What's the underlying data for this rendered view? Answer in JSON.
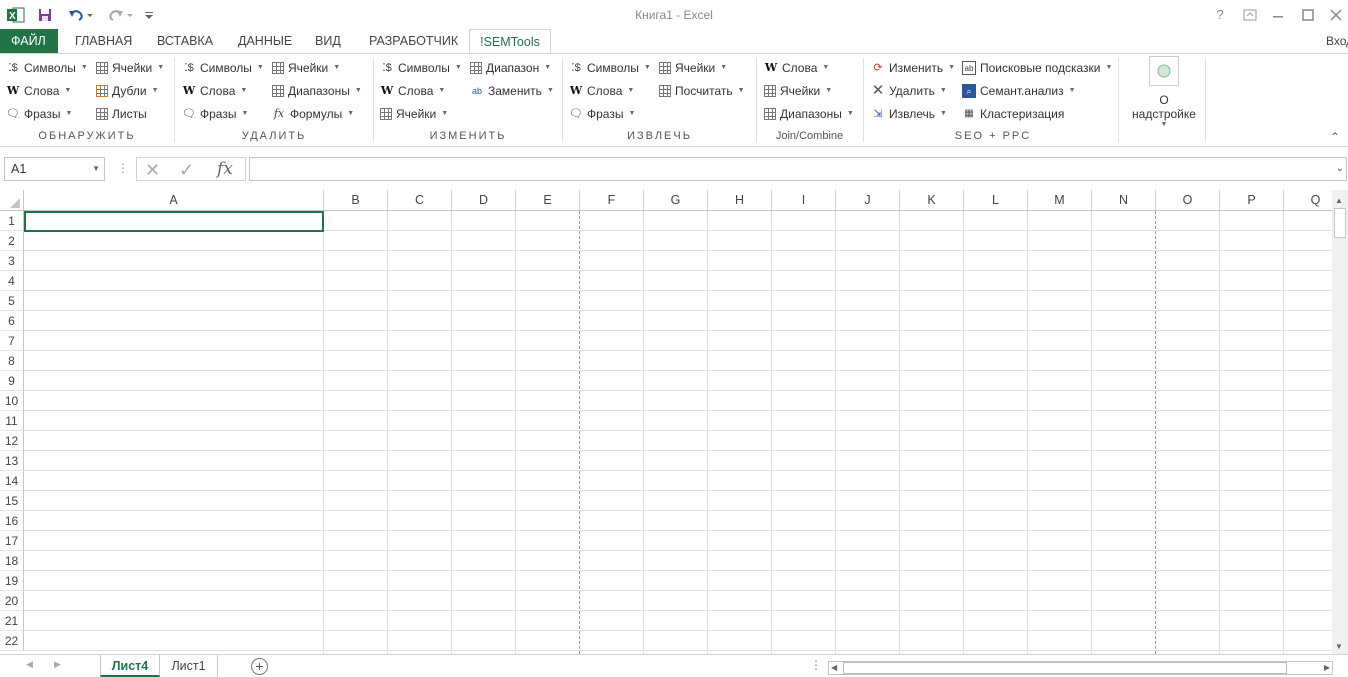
{
  "app": {
    "title": "Книга1 - Excel",
    "sign_in": "Вход",
    "help": "?"
  },
  "tabs": [
    "ФАЙЛ",
    "ГЛАВНАЯ",
    "ВСТАВКА",
    "ДАННЫЕ",
    "ВИД",
    "РАЗРАБОТЧИК",
    "!SEMTools"
  ],
  "ribbon": {
    "g1": {
      "label": "ОБНАРУЖИТЬ",
      "symbols": "Символы",
      "words": "Слова",
      "phrases": "Фразы",
      "cells": "Ячейки",
      "dupes": "Дубли",
      "sheets": "Листы"
    },
    "g2": {
      "label": "УДАЛИТЬ",
      "symbols": "Символы",
      "words": "Слова",
      "phrases": "Фразы",
      "cells": "Ячейки",
      "ranges": "Диапазоны",
      "formulas": "Формулы"
    },
    "g3": {
      "label": "ИЗМЕНИТЬ",
      "symbols": "Символы",
      "words": "Слова",
      "cells": "Ячейки",
      "range": "Диапазон",
      "replace": "Заменить"
    },
    "g4": {
      "label": "ИЗВЛЕЧЬ",
      "symbols": "Символы",
      "words": "Слова",
      "phrases": "Фразы",
      "cells": "Ячейки",
      "count": "Посчитать"
    },
    "g5": {
      "label": "Join/Combine",
      "words": "Слова",
      "cells": "Ячейки",
      "ranges": "Диапазоны"
    },
    "g6": {
      "label": "SEO + PPC",
      "change": "Изменить",
      "delete": "Удалить",
      "extract": "Извлечь",
      "search_hints": "Поисковые подсказки",
      "semantic": "Семант.анализ",
      "cluster": "Кластеризация"
    },
    "g7": {
      "about": "О надстройке"
    }
  },
  "formula_bar": {
    "name_box": "A1",
    "fx": "fx",
    "value": ""
  },
  "columns": [
    "A",
    "B",
    "C",
    "D",
    "E",
    "F",
    "G",
    "H",
    "I",
    "J",
    "K",
    "L",
    "M",
    "N",
    "O",
    "P",
    "Q"
  ],
  "rows": [
    "1",
    "2",
    "3",
    "4",
    "5",
    "6",
    "7",
    "8",
    "9",
    "10",
    "11",
    "12",
    "13",
    "14",
    "15",
    "16",
    "17",
    "18",
    "19",
    "20",
    "21",
    "22"
  ],
  "sheets": {
    "active": "Лист4",
    "other": "Лист1"
  },
  "colors": {
    "accent": "#217346",
    "grid": "#e1e1e1"
  }
}
